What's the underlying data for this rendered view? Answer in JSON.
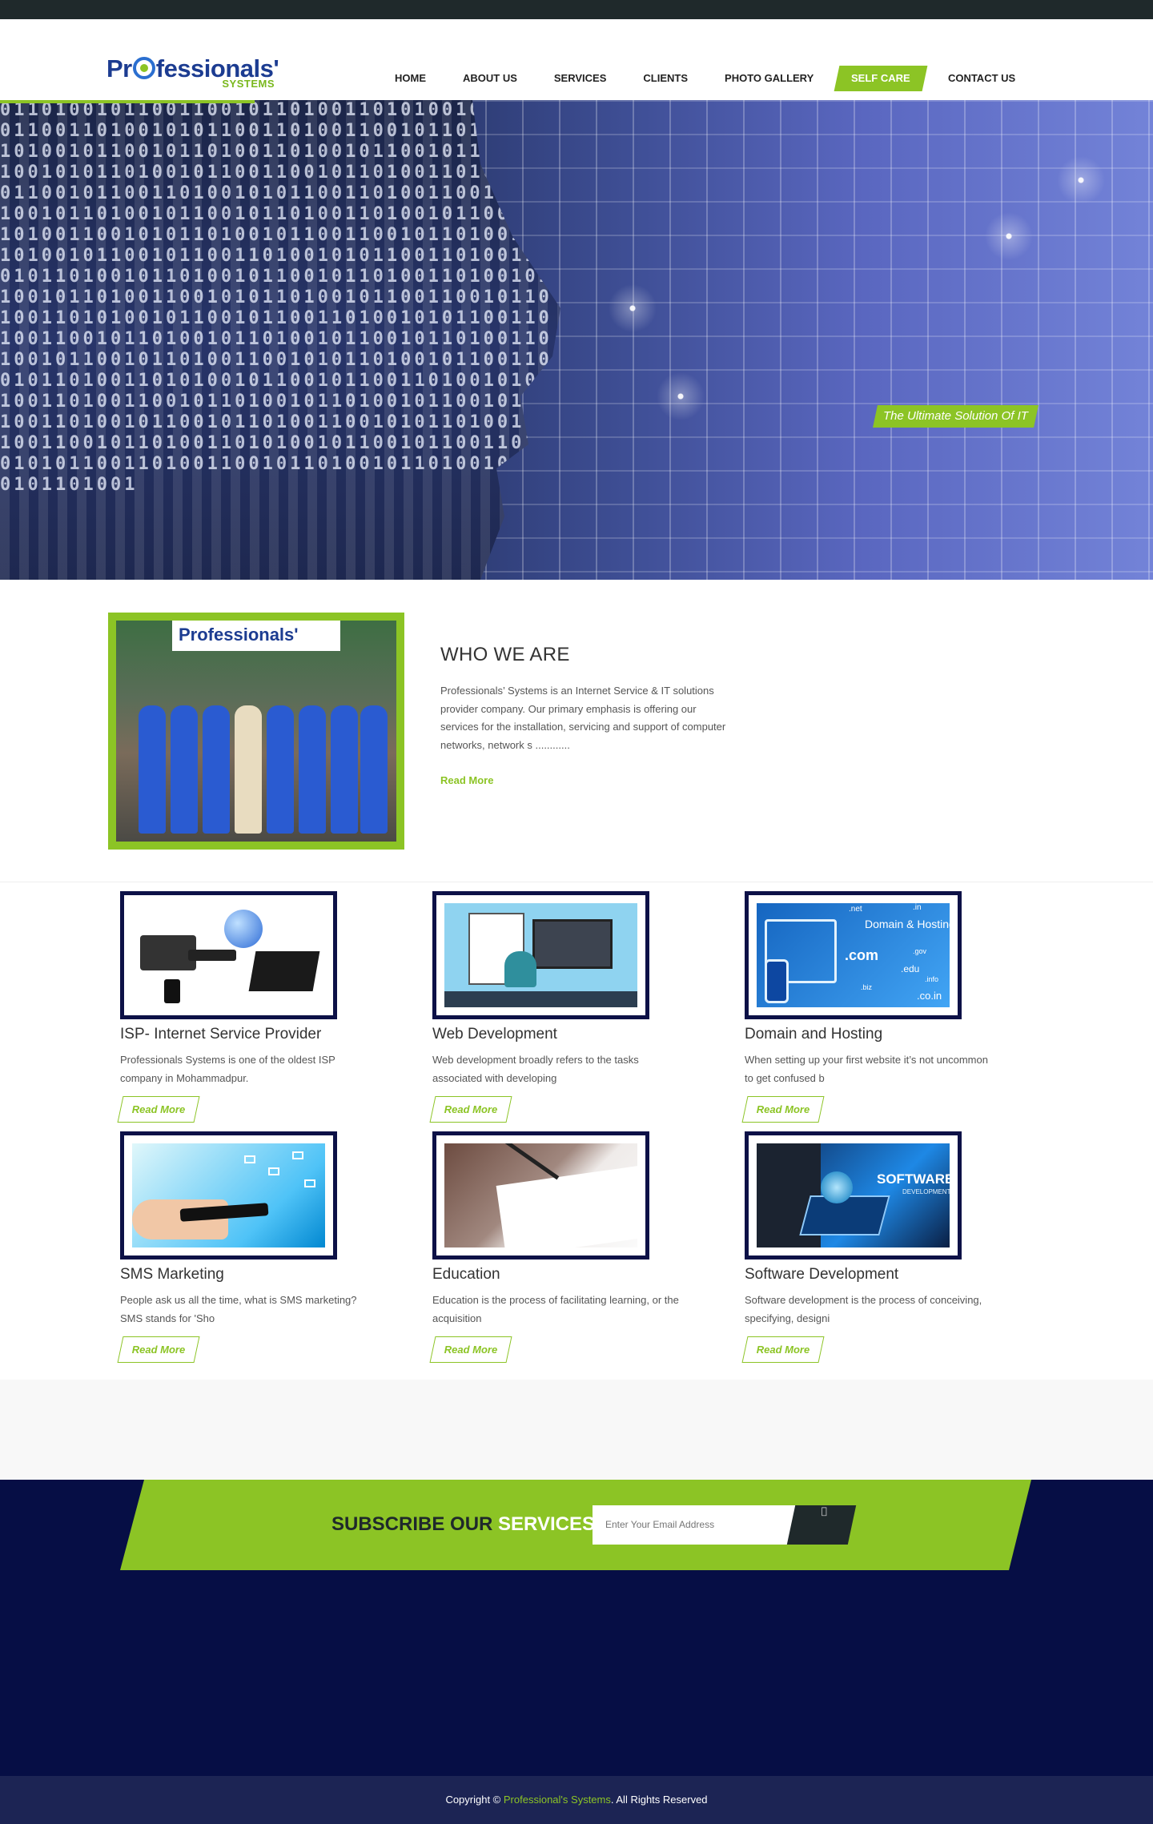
{
  "brand": {
    "logo_word": "Pr",
    "logo_word_tail": "fessionals'",
    "logo_sub": "SYSTEMS"
  },
  "nav": {
    "items": [
      {
        "label": "HOME"
      },
      {
        "label": "ABOUT US"
      },
      {
        "label": "SERVICES"
      },
      {
        "label": "CLIENTS"
      },
      {
        "label": "PHOTO GALLERY"
      },
      {
        "label": "SELF CARE",
        "active": true
      },
      {
        "label": "CONTACT US"
      }
    ]
  },
  "hero": {
    "tagline": "The Ultimate Solution Of IT"
  },
  "about": {
    "photo_banner": "Professionals'",
    "title": "WHO WE ARE",
    "text": "Professionals’ Systems is an Internet Service & IT solutions provider company. Our primary emphasis is offering our services for the installation, servicing and support of computer networks, network s ............",
    "read_more": "Read More"
  },
  "services": [
    {
      "title": "ISP- Internet Service Provider",
      "text": "Professionals Systems is one of the oldest ISP company in Mohammadpur.",
      "read_more": "Read More"
    },
    {
      "title": "Web Development",
      "text": "Web development broadly refers to the tasks associated with developing",
      "read_more": "Read More"
    },
    {
      "title": "Domain and Hosting",
      "text": "When setting up your first website it’s not uncommon to get confused b",
      "read_more": "Read More"
    },
    {
      "title": "SMS Marketing",
      "text": "People ask us all the time, what is SMS marketing? SMS stands for 'Sho",
      "read_more": "Read More"
    },
    {
      "title": "Education",
      "text": "Education is the process of facilitating learning, or the acquisition",
      "read_more": "Read More"
    },
    {
      "title": "Software Development",
      "text": "Software development is the process of conceiving, specifying, designi",
      "read_more": "Read More"
    }
  ],
  "thumbs": {
    "domain_label": "Domain & Hosting",
    "domain_tlds": [
      ".net",
      ".in",
      ".com",
      ".gov",
      ".edu",
      ".info",
      ".biz",
      ".co.in"
    ],
    "software_label": "SOFTWARE",
    "software_sub": "DEVELOPMENT"
  },
  "subscribe": {
    "title_dark": "SUBSCRIBE OUR",
    "title_light": "SERVICES",
    "placeholder": "Enter Your Email Address",
    "button_icon": "send-icon"
  },
  "footer": {
    "prefix": "Copyright ©",
    "brand": "Professional's Systems",
    "suffix": ". All Rights Reserved"
  },
  "colors": {
    "accent": "#8cc425",
    "navy": "#0d1147",
    "dark": "#1f292b",
    "footer": "#1c2454"
  }
}
